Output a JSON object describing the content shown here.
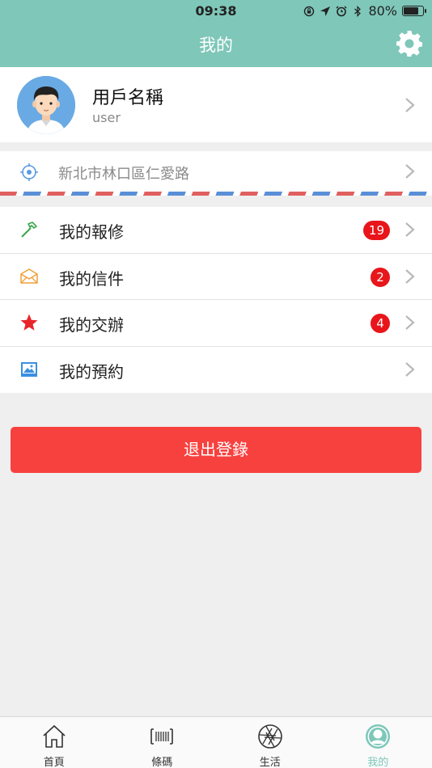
{
  "status_bar": {
    "time": "09:38",
    "battery": "80%",
    "battery_level": 0.8,
    "icons": [
      "orientation-lock-icon",
      "location-arrow-icon",
      "alarm-icon",
      "bluetooth-icon",
      "battery-icon"
    ]
  },
  "header": {
    "title": "我的",
    "settings_icon": "gear-icon",
    "bg_color": "#7ec7b9"
  },
  "profile": {
    "name": "用戶名稱",
    "username": "user",
    "avatar_icon": "user-avatar"
  },
  "address": {
    "text": "新北市林口區仁愛路",
    "icon": "location-target-icon"
  },
  "menu": {
    "items": [
      {
        "label": "我的報修",
        "icon": "hammer-icon",
        "icon_color": "#3aa64a",
        "badge": "19"
      },
      {
        "label": "我的信件",
        "icon": "envelope-icon",
        "icon_color": "#f0a03a",
        "badge": "2"
      },
      {
        "label": "我的交辦",
        "icon": "star-icon",
        "icon_color": "#e8252a",
        "badge": "4"
      },
      {
        "label": "我的預約",
        "icon": "image-icon",
        "icon_color": "#3a8fe0",
        "badge": ""
      }
    ]
  },
  "logout": {
    "label": "退出登錄",
    "color": "#f7413f"
  },
  "tabbar": {
    "tabs": [
      {
        "label": "首頁",
        "icon": "home-icon",
        "active": false
      },
      {
        "label": "條碼",
        "icon": "barcode-icon",
        "active": false
      },
      {
        "label": "生活",
        "icon": "aperture-icon",
        "active": false
      },
      {
        "label": "我的",
        "icon": "profile-icon",
        "active": true
      }
    ],
    "active_color": "#7ec7b9"
  }
}
